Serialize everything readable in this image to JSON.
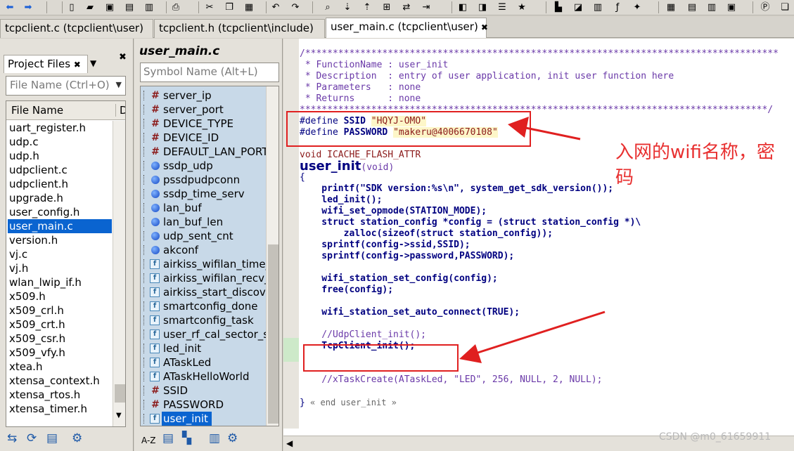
{
  "toolbar": {
    "icons": [
      "back-arrow-icon",
      "forward-arrow-icon",
      "new-file-icon",
      "open-folder-icon",
      "save-icon",
      "save-as-icon",
      "save-all-icon",
      "print-icon",
      "cut-icon",
      "copy-icon",
      "paste-icon",
      "undo-icon",
      "redo-icon",
      "find-icon",
      "find-next-icon",
      "find-prev-icon",
      "find-files-icon",
      "replace-icon",
      "goto-icon",
      "bookmark-prev-icon",
      "bookmark-next-icon",
      "bookmark-list-icon",
      "bookmark-add-icon",
      "browse-icon",
      "reference-icon",
      "symbol-icon",
      "fx-icon",
      "build-icon",
      "layout-1-icon",
      "layout-2-icon",
      "layout-3-icon",
      "layout-4-icon",
      "project-icon",
      "windows-icon"
    ]
  },
  "tabs": [
    {
      "label": "tcpclient.c (tcpclient\\user)",
      "active": false
    },
    {
      "label": "tcpclient.h (tcpclient\\include)",
      "active": false
    },
    {
      "label": "user_main.c (tcpclient\\user)",
      "active": true,
      "close": "✖"
    }
  ],
  "project_files": {
    "tab_label": "Project Files",
    "tab_close": "✖",
    "dropdown": "▼",
    "pane_close": "✖",
    "search_placeholder": "File Name (Ctrl+O)",
    "search_dropdown": "▼",
    "column_name": "File Name",
    "column_2": "Di",
    "files": [
      {
        "name": "uart_register.h"
      },
      {
        "name": "udp.c"
      },
      {
        "name": "udp.h"
      },
      {
        "name": "udpclient.c"
      },
      {
        "name": "udpclient.h"
      },
      {
        "name": "upgrade.h"
      },
      {
        "name": "user_config.h"
      },
      {
        "name": "user_main.c",
        "selected": true
      },
      {
        "name": "version.h"
      },
      {
        "name": "vj.c"
      },
      {
        "name": "vj.h"
      },
      {
        "name": "wlan_lwip_if.h"
      },
      {
        "name": "x509.h"
      },
      {
        "name": "x509_crl.h"
      },
      {
        "name": "x509_crt.h"
      },
      {
        "name": "x509_csr.h"
      },
      {
        "name": "x509_vfy.h"
      },
      {
        "name": "xtea.h"
      },
      {
        "name": "xtensa_context.h"
      },
      {
        "name": "xtensa_rtos.h"
      },
      {
        "name": "xtensa_timer.h"
      }
    ],
    "scroll_arrow": "▼",
    "bottom_icons": [
      "sync-icon",
      "refresh-icon",
      "list-icon",
      "settings-icon"
    ]
  },
  "symbols": {
    "title": "user_main.c",
    "search_placeholder": "Symbol Name (Alt+L)",
    "items": [
      {
        "name": "server_ip",
        "kind": "define"
      },
      {
        "name": "server_port",
        "kind": "define"
      },
      {
        "name": "DEVICE_TYPE",
        "kind": "define"
      },
      {
        "name": "DEVICE_ID",
        "kind": "define"
      },
      {
        "name": "DEFAULT_LAN_PORT",
        "kind": "define"
      },
      {
        "name": "ssdp_udp",
        "kind": "var"
      },
      {
        "name": "pssdpudpconn",
        "kind": "var"
      },
      {
        "name": "ssdp_time_serv",
        "kind": "var"
      },
      {
        "name": "lan_buf",
        "kind": "var"
      },
      {
        "name": "lan_buf_len",
        "kind": "var"
      },
      {
        "name": "udp_sent_cnt",
        "kind": "var"
      },
      {
        "name": "akconf",
        "kind": "var"
      },
      {
        "name": "airkiss_wifilan_time_callback",
        "kind": "func"
      },
      {
        "name": "airkiss_wifilan_recv_callbk",
        "kind": "func"
      },
      {
        "name": "airkiss_start_discover",
        "kind": "func"
      },
      {
        "name": "smartconfig_done",
        "kind": "func"
      },
      {
        "name": "smartconfig_task",
        "kind": "func"
      },
      {
        "name": "user_rf_cal_sector_set",
        "kind": "func"
      },
      {
        "name": "led_init",
        "kind": "func"
      },
      {
        "name": "ATaskLed",
        "kind": "func"
      },
      {
        "name": "ATaskHelloWorld",
        "kind": "func"
      },
      {
        "name": "SSID",
        "kind": "define"
      },
      {
        "name": "PASSWORD",
        "kind": "define"
      },
      {
        "name": "user_init",
        "kind": "func",
        "selected": true
      }
    ],
    "bottom_icons": [
      "sort-az-icon",
      "list-view-icon",
      "category-icon",
      "book-icon",
      "settings-icon"
    ],
    "sort_label": "A-Z"
  },
  "editor": {
    "lines": [
      {
        "text": "/**************************************************************************************",
        "cls": "c-comment"
      },
      {
        "text": " * FunctionName : user_init",
        "cls": "c-comment"
      },
      {
        "text": " * Description  : entry of user application, init user function here",
        "cls": "c-comment"
      },
      {
        "text": " * Parameters   : none",
        "cls": "c-comment"
      },
      {
        "text": " * Returns      : none",
        "cls": "c-comment"
      },
      {
        "text": "*************************************************************************************/",
        "cls": "c-comment"
      },
      {
        "text": "#define SSID \"HQYJ-OMO\"",
        "cls": "define",
        "parts": [
          "#define ",
          "SSID",
          " ",
          "\"HQYJ-OMO\""
        ]
      },
      {
        "text": "#define PASSWORD \"makeru@4006670108\"",
        "cls": "define",
        "parts": [
          "#define ",
          "PASSWORD",
          " ",
          "\"makeru@4006670108\""
        ]
      },
      {
        "text": "",
        "cls": ""
      },
      {
        "text": "void ICACHE_FLASH_ATTR",
        "cls": "c-macro"
      },
      {
        "text": "user_init(void)",
        "cls": "fnhead",
        "parts": [
          "user_init",
          "(void)"
        ]
      },
      {
        "text": "{",
        "cls": "c-plain"
      },
      {
        "text": "    printf(\"SDK version:%s\\n\", system_get_sdk_version());",
        "cls": "c-fn"
      },
      {
        "text": "    led_init();",
        "cls": "c-fn"
      },
      {
        "text": "    wifi_set_opmode(STATION_MODE);",
        "cls": "c-fn"
      },
      {
        "text": "    struct station_config *config = (struct station_config *)\\",
        "cls": "c-fn"
      },
      {
        "text": "        zalloc(sizeof(struct station_config));",
        "cls": "c-fn"
      },
      {
        "text": "    sprintf(config->ssid,SSID);",
        "cls": "c-fn"
      },
      {
        "text": "    sprintf(config->password,PASSWORD);",
        "cls": "c-fn"
      },
      {
        "text": "",
        "cls": ""
      },
      {
        "text": "    wifi_station_set_config(config);",
        "cls": "c-fn"
      },
      {
        "text": "    free(config);",
        "cls": "c-fn"
      },
      {
        "text": "",
        "cls": ""
      },
      {
        "text": "    wifi_station_set_auto_connect(TRUE);",
        "cls": "c-fn"
      },
      {
        "text": "",
        "cls": ""
      },
      {
        "text": "    //UdpClient_init();",
        "cls": "c-comment"
      },
      {
        "text": "    TcpClient_init();",
        "cls": "c-fn"
      },
      {
        "text": "",
        "cls": ""
      },
      {
        "text": "",
        "cls": ""
      },
      {
        "text": "    //xTaskCreate(ATaskLed, \"LED\", 256, NULL, 2, NULL);",
        "cls": "c-comment"
      },
      {
        "text": "",
        "cls": ""
      },
      {
        "text": "} « end user_init »",
        "cls": "endline",
        "parts": [
          "}",
          " « end user_init »"
        ]
      }
    ],
    "bottom_arrow": "◀"
  },
  "annotation": {
    "text": "入网的wifi名称，密码",
    "color": "#e02020"
  },
  "watermark": "CSDN @m0_61659911"
}
